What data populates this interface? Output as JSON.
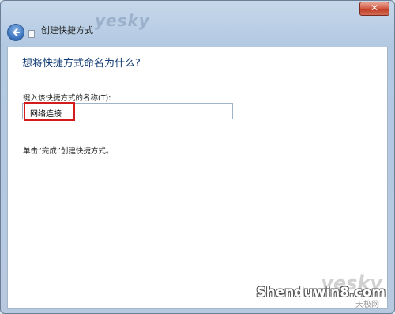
{
  "window": {
    "close_glyph": "✕"
  },
  "wizard": {
    "title": "创建快捷方式",
    "heading": "想将快捷方式命名为什么?",
    "field_label": "键入该快捷方式的名称(T):",
    "field_value": "网络连接",
    "hint": "单击“完成”创建快捷方式。"
  },
  "watermarks": {
    "top_logo": "yesky",
    "bottom_logo": "yesky",
    "bottom_site": "Shenduwin8.com",
    "bottom_cn": "天极网"
  },
  "colors": {
    "highlight_border": "#d51c1c",
    "heading": "#153e75"
  },
  "icons": {
    "back": "back-arrow-icon",
    "wizard": "shortcut-wizard-icon",
    "close": "close-icon"
  }
}
